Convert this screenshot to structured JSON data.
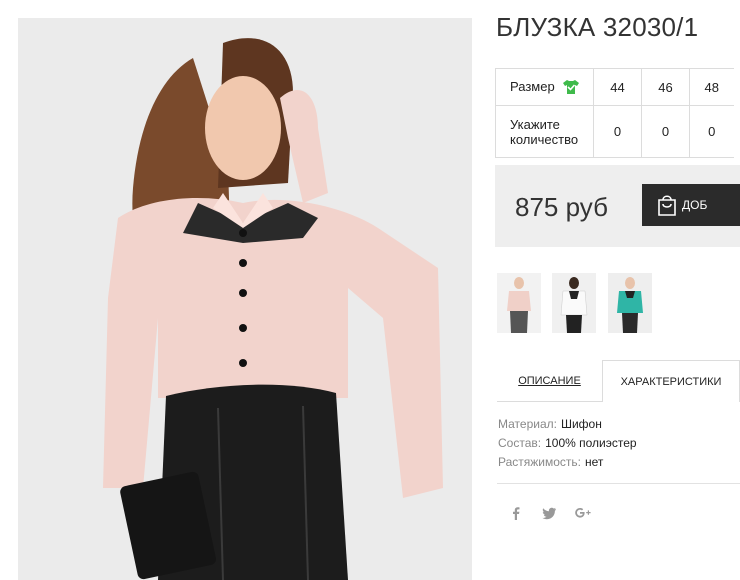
{
  "product": {
    "title": "БЛУЗКА 32030/1"
  },
  "size_table": {
    "size_label": "Размер",
    "qty_label_line1": "Укажите",
    "qty_label_line2": "количество",
    "sizes": [
      "44",
      "46",
      "48"
    ],
    "quantities": [
      "0",
      "0",
      "0"
    ]
  },
  "purchase": {
    "price": "875 руб",
    "cart_button_label": "ДОБ"
  },
  "tabs": {
    "description": "ОПИСАНИЕ",
    "characteristics": "ХАРАКТЕРИСТИКИ"
  },
  "characteristics": [
    {
      "key": "Материал:",
      "value": "Шифон"
    },
    {
      "key": "Состав:",
      "value": "100% полиэстер"
    },
    {
      "key": "Растяжимость:",
      "value": "нет"
    }
  ],
  "icons": {
    "size_chart": "shirt-icon",
    "cart": "shopping-bag-icon",
    "social": [
      "facebook-icon",
      "twitter-icon",
      "google-plus-icon"
    ]
  },
  "colors": {
    "size_icon": "#3fba4b",
    "cart_button": "#2b2b2b",
    "price_box": "#eeeeee",
    "thumb_teal_blouse": "#2fb5a6"
  }
}
